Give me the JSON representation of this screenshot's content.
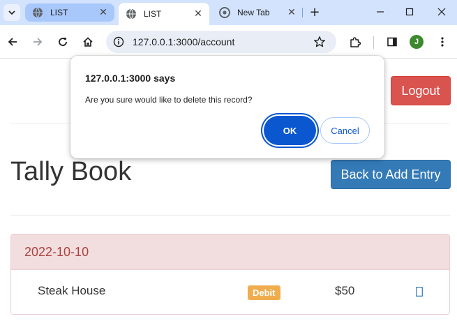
{
  "browser": {
    "tabs": [
      {
        "title": "LIST",
        "active": false
      },
      {
        "title": "LIST",
        "active": true
      },
      {
        "title": "New Tab",
        "active": false
      }
    ],
    "url": "127.0.0.1:3000/account",
    "profile_initial": "J"
  },
  "page": {
    "logout_label": "Logout",
    "title": "Tally Book",
    "back_label": "Back to Add Entry",
    "entries": [
      {
        "date": "2022-10-10",
        "name": "Steak House",
        "type": "Debit",
        "amount": "$50"
      }
    ]
  },
  "dialog": {
    "title": "127.0.0.1:3000 says",
    "message": "Are you sure would like to delete this record?",
    "ok_label": "OK",
    "cancel_label": "Cancel"
  },
  "colors": {
    "danger": "#d9534f",
    "primary": "#337ab7",
    "panel_heading_bg": "#f2dede",
    "panel_heading_text": "#a94442",
    "badge_warning": "#f0ad4e",
    "dialog_ok": "#0b57d0"
  }
}
